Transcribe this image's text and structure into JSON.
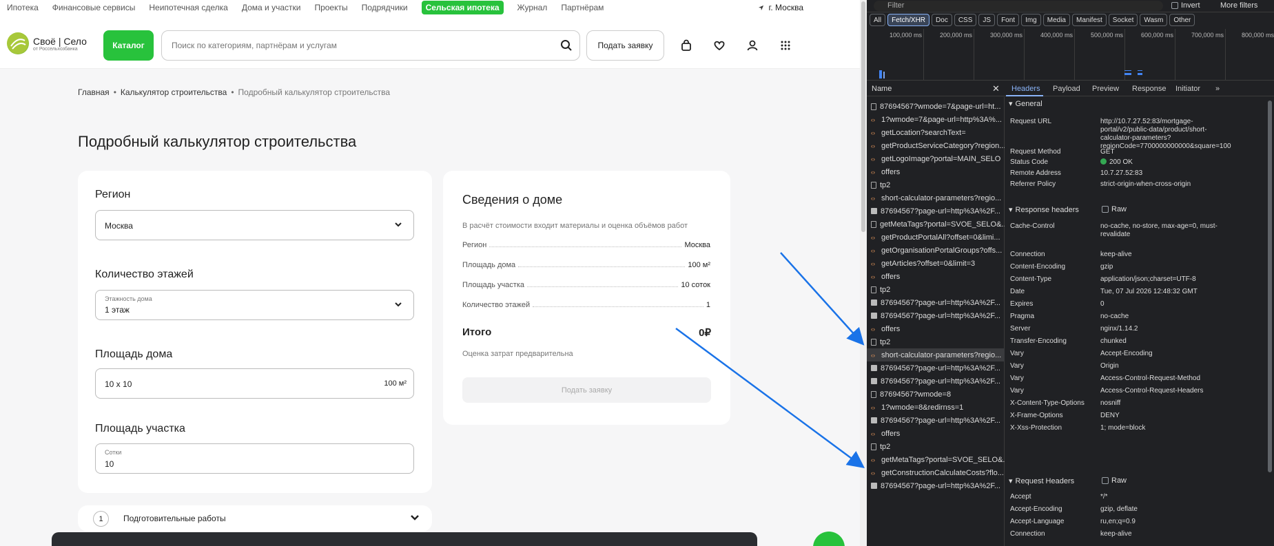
{
  "topnav": {
    "items": [
      "Ипотека",
      "Финансовые сервисы",
      "Неипотечная сделка",
      "Дома и участки",
      "Проекты",
      "Подрядчики",
      "Сельская ипотека",
      "Журнал",
      "Партнёрам"
    ],
    "active_index": 6,
    "city": "г. Москва"
  },
  "header": {
    "logo_line1": "Своё | Село",
    "logo_line2": "от Россельхозбанка",
    "catalog_label": "Каталог",
    "search_placeholder": "Поиск по категориям, партнёрам и услугам",
    "apply_label": "Подать заявку"
  },
  "breadcrumb": [
    "Главная",
    "Калькулятор строительства",
    "Подробный калькулятор строительства"
  ],
  "page_title": "Подробный калькулятор строительства",
  "form": {
    "region_label": "Регион",
    "region_value": "Москва",
    "floors_label": "Количество этажей",
    "floors_sub": "Этажность дома",
    "floors_value": "1 этаж",
    "house_area_label": "Площадь дома",
    "house_area_value": "10 x 10",
    "house_area_unit": "100 м²",
    "plot_label": "Площадь участка",
    "plot_sub": "Сотки",
    "plot_value": "10"
  },
  "summary": {
    "title": "Сведения о доме",
    "note": "В расчёт стоимости входит материалы и оценка объёмов работ",
    "rows": [
      {
        "label": "Регион",
        "value": "Москва"
      },
      {
        "label": "Площадь дома",
        "value": "100 м²"
      },
      {
        "label": "Площадь участка",
        "value": "10 соток"
      },
      {
        "label": "Количество этажей",
        "value": "1"
      }
    ],
    "total_label": "Итого",
    "total_value": "0₽",
    "total_note": "Оценка затрат предварительна",
    "apply_label": "Подать заявку"
  },
  "accordion": {
    "number": "1",
    "label": "Подготовительные работы"
  },
  "devtools": {
    "filter_placeholder": "Filter",
    "invert_label": "Invert",
    "more_filters": "More filters",
    "types": [
      "All",
      "Fetch/XHR",
      "Doc",
      "CSS",
      "JS",
      "Font",
      "Img",
      "Media",
      "Manifest",
      "Socket",
      "Wasm",
      "Other"
    ],
    "active_type": 1,
    "ticks": [
      "100,000 ms",
      "200,000 ms",
      "300,000 ms",
      "400,000 ms",
      "500,000 ms",
      "600,000 ms",
      "700,000 ms",
      "800,000 ms"
    ],
    "name_header": "Name",
    "tabs": [
      "Headers",
      "Payload",
      "Preview",
      "Response",
      "Initiator"
    ],
    "requests": [
      {
        "name": "87694567?wmode=7&page-url=ht...",
        "type": "doc"
      },
      {
        "name": "1?wmode=7&page-url=http%3A%...",
        "type": "xhr"
      },
      {
        "name": "getLocation?searchText=",
        "type": "xhr"
      },
      {
        "name": "getProductServiceCategory?region...",
        "type": "xhr"
      },
      {
        "name": "getLogoImage?portal=MAIN_SELO",
        "type": "xhr"
      },
      {
        "name": "offers",
        "type": "xhr"
      },
      {
        "name": "tp2",
        "type": "doc"
      },
      {
        "name": "short-calculator-parameters?regio...",
        "type": "xhr"
      },
      {
        "name": "87694567?page-url=http%3A%2F...",
        "type": "img"
      },
      {
        "name": "getMetaTags?portal=SVOE_SELO&...",
        "type": "doc"
      },
      {
        "name": "getProductPortalAll?offset=0&limi...",
        "type": "xhr"
      },
      {
        "name": "getOrganisationPortalGroups?offs...",
        "type": "xhr"
      },
      {
        "name": "getArticles?offset=0&limit=3",
        "type": "xhr"
      },
      {
        "name": "offers",
        "type": "xhr"
      },
      {
        "name": "tp2",
        "type": "doc"
      },
      {
        "name": "87694567?page-url=http%3A%2F...",
        "type": "img"
      },
      {
        "name": "87694567?page-url=http%3A%2F...",
        "type": "img"
      },
      {
        "name": "offers",
        "type": "xhr"
      },
      {
        "name": "tp2",
        "type": "doc"
      },
      {
        "name": "short-calculator-parameters?regio...",
        "type": "xhr"
      },
      {
        "name": "87694567?page-url=http%3A%2F...",
        "type": "img"
      },
      {
        "name": "87694567?page-url=http%3A%2F...",
        "type": "img"
      },
      {
        "name": "87694567?wmode=8",
        "type": "doc"
      },
      {
        "name": "1?wmode=8&redirnss=1",
        "type": "xhr"
      },
      {
        "name": "87694567?page-url=http%3A%2F...",
        "type": "img"
      },
      {
        "name": "offers",
        "type": "xhr"
      },
      {
        "name": "tp2",
        "type": "doc"
      },
      {
        "name": "getMetaTags?portal=SVOE_SELO&...",
        "type": "xhr"
      },
      {
        "name": "getConstructionCalculateCosts?flo...",
        "type": "xhr"
      },
      {
        "name": "87694567?page-url=http%3A%2F...",
        "type": "img"
      }
    ],
    "selected_request": 19,
    "general_title": "General",
    "general": [
      {
        "k": "Request URL",
        "v": "http://10.7.27.52:83/mortgage-portal/v2/public-data/product/short-calculator-parameters?regionCode=7700000000000&square=100"
      },
      {
        "k": "Request Method",
        "v": "GET"
      },
      {
        "k": "Status Code",
        "v": "200 OK"
      },
      {
        "k": "Remote Address",
        "v": "10.7.27.52:83"
      },
      {
        "k": "Referrer Policy",
        "v": "strict-origin-when-cross-origin"
      }
    ],
    "response_title": "Response headers",
    "raw_label": "Raw",
    "response": [
      {
        "k": "Cache-Control",
        "v": "no-cache, no-store, max-age=0, must-revalidate"
      },
      {
        "k": "Connection",
        "v": "keep-alive"
      },
      {
        "k": "Content-Encoding",
        "v": "gzip"
      },
      {
        "k": "Content-Type",
        "v": "application/json;charset=UTF-8"
      },
      {
        "k": "Date",
        "v": "Tue, 07 Jul 2026 12:48:32 GMT"
      },
      {
        "k": "Expires",
        "v": "0"
      },
      {
        "k": "Pragma",
        "v": "no-cache"
      },
      {
        "k": "Server",
        "v": "nginx/1.14.2"
      },
      {
        "k": "Transfer-Encoding",
        "v": "chunked"
      },
      {
        "k": "Vary",
        "v": "Accept-Encoding"
      },
      {
        "k": "Vary",
        "v": "Origin"
      },
      {
        "k": "Vary",
        "v": "Access-Control-Request-Method"
      },
      {
        "k": "Vary",
        "v": "Access-Control-Request-Headers"
      },
      {
        "k": "X-Content-Type-Options",
        "v": "nosniff"
      },
      {
        "k": "X-Frame-Options",
        "v": "DENY"
      },
      {
        "k": "X-Xss-Protection",
        "v": "1; mode=block"
      }
    ],
    "request_title": "Request Headers",
    "request": [
      {
        "k": "Accept",
        "v": "*/*"
      },
      {
        "k": "Accept-Encoding",
        "v": "gzip, deflate"
      },
      {
        "k": "Accept-Language",
        "v": "ru,en;q=0.9"
      },
      {
        "k": "Connection",
        "v": "keep-alive"
      }
    ]
  },
  "colors": {
    "brand_green": "#28c23c",
    "arrow_blue": "#1a73e8",
    "devtools_bg": "#202124",
    "accent_blue": "#8ab4f8"
  }
}
